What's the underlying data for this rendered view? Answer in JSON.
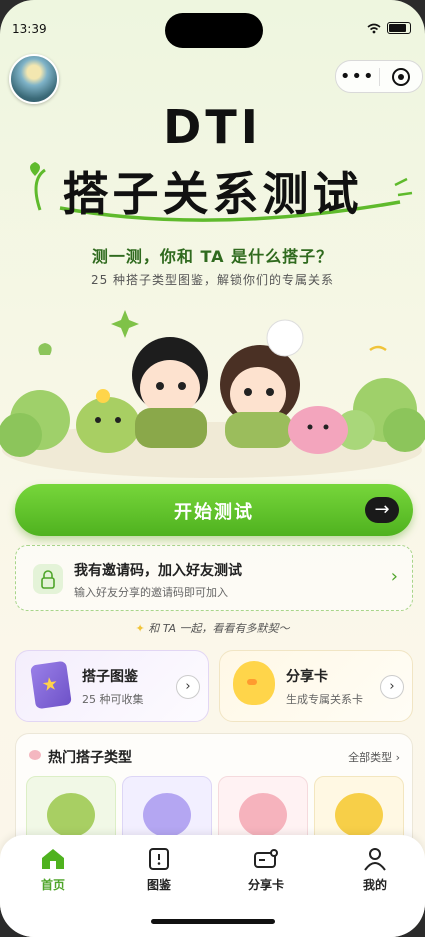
{
  "status": {
    "time": "13:39"
  },
  "header": {
    "title_en": "DTI",
    "title_cn": "搭子关系测试"
  },
  "intro": {
    "line1": "测一测，你和 TA 是什么搭子？",
    "line2": "25 种搭子类型图鉴，解锁你们的专属关系"
  },
  "start_button": {
    "label": "开始测试",
    "arrow": "→"
  },
  "invite": {
    "title": "我有邀请码，加入好友测试",
    "desc": "输入好友分享的邀请码即可加入",
    "chevron": "›"
  },
  "tagline": "和 TA 一起，看看有多默契～",
  "cards": [
    {
      "title": "搭子图鉴",
      "sub": "25 种可收集",
      "icon": "book-icon"
    },
    {
      "title": "分享卡",
      "sub": "生成专属关系卡",
      "icon": "chick-icon"
    }
  ],
  "hot": {
    "title": "热门搭子类型",
    "all": "全部类型 ›"
  },
  "tabs": [
    {
      "label": "首页",
      "icon": "home-icon"
    },
    {
      "label": "图鉴",
      "icon": "book-icon"
    },
    {
      "label": "分享卡",
      "icon": "card-icon"
    },
    {
      "label": "我的",
      "icon": "person-icon"
    }
  ],
  "colors": {
    "accent": "#4fb21f",
    "accent_light": "#77d63b",
    "text": "#222222"
  }
}
